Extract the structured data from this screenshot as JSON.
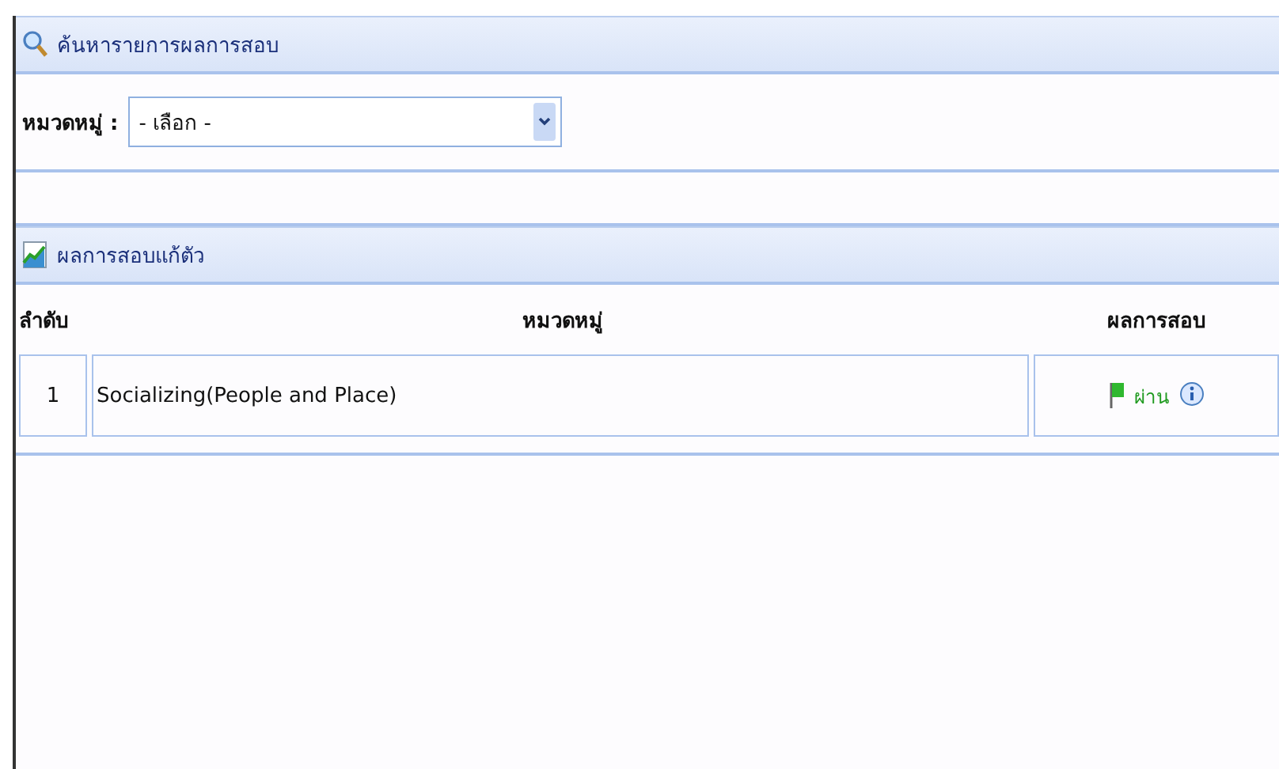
{
  "search_panel": {
    "title": "ค้นหารายการผลการสอบ",
    "category_label": "หมวดหมู่ :",
    "category_select": {
      "value": "- เลือก -"
    }
  },
  "results_panel": {
    "title": "ผลการสอบแก้ตัว",
    "table": {
      "columns": [
        "ลำดับ",
        "หมวดหมู่",
        "ผลการสอบ"
      ],
      "rows": [
        {
          "index": "1",
          "category": "Socializing(People and Place)",
          "result": "ผ่าน",
          "passed": true
        }
      ]
    }
  }
}
